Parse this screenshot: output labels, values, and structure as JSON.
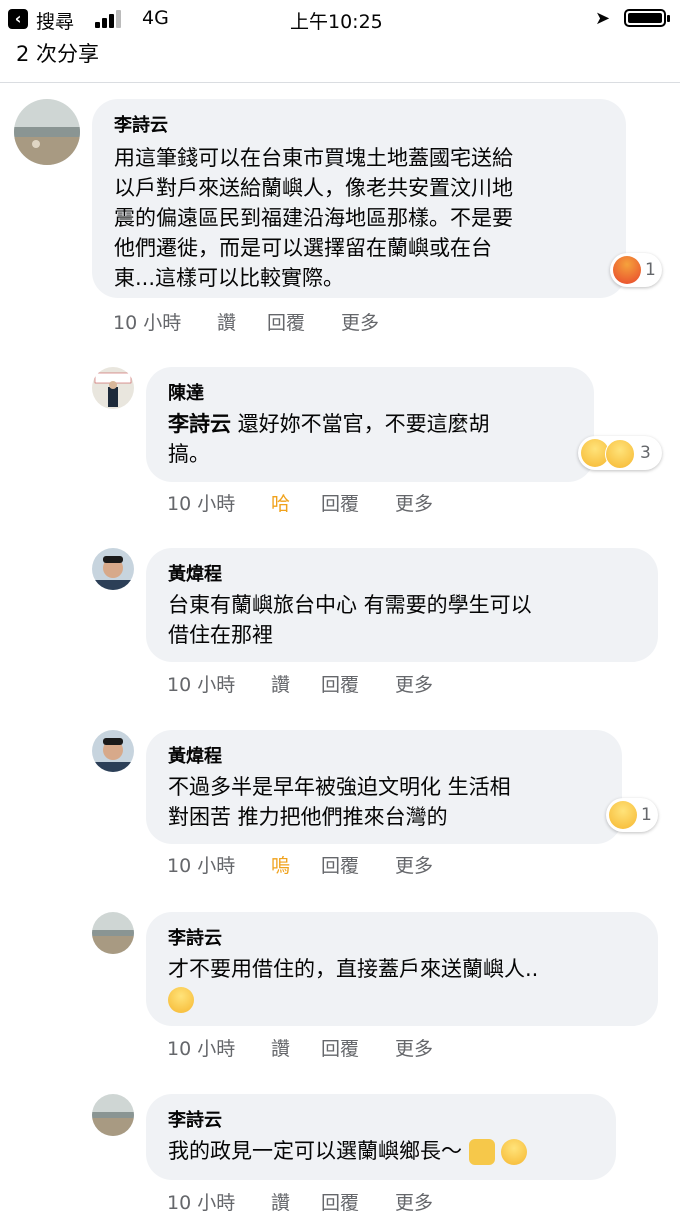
{
  "status": {
    "back_app": "搜尋",
    "network": "4G",
    "time": "上午10:25"
  },
  "share_count": "2 次分享",
  "comments": [
    {
      "author": "李詩云",
      "lines": [
        "用這筆錢可以在台東市買塊土地蓋國宅送給",
        "以戶對戶來送給蘭嶼人，像老共安置汶川地",
        "震的偏遠區民到福建沿海地區那樣。不是要",
        "他們遷徙，而是可以選擇留在蘭嶼或在台",
        "東...這樣可以比較實際。"
      ],
      "time": "10 小時",
      "like": "讚",
      "reply": "回覆",
      "more": "更多",
      "reaction": "angry-emoji",
      "reaction_count": "1"
    },
    {
      "author": "陳達",
      "mention": "李詩云",
      "line1": " 還好妳不當官，不要這麼胡",
      "line2": "搞。",
      "time": "10 小時",
      "like": "哈",
      "reply": "回覆",
      "more": "更多",
      "reactions": [
        "haha-emoji",
        "wow-emoji"
      ],
      "reaction_count": "3"
    },
    {
      "author": "黃煒程",
      "lines": [
        "台東有蘭嶼旅台中心 有需要的學生可以",
        "借住在那裡"
      ],
      "time": "10 小時",
      "like": "讚",
      "reply": "回覆",
      "more": "更多"
    },
    {
      "author": "黃煒程",
      "lines": [
        "不過多半是早年被強迫文明化 生活相",
        "對困苦 推力把他們推來台灣的"
      ],
      "time": "10 小時",
      "like": "嗚",
      "reply": "回覆",
      "more": "更多",
      "reaction": "sad-emoji",
      "reaction_count": "1"
    },
    {
      "author": "李詩云",
      "lines": [
        "才不要用借住的，直接蓋戶來送蘭嶼人.."
      ],
      "time": "10 小時",
      "like": "讚",
      "reply": "回覆",
      "more": "更多"
    },
    {
      "author": "李詩云",
      "lines": [
        "我的政見一定可以選蘭嶼鄉長～"
      ],
      "time": "10 小時",
      "like": "讚",
      "reply": "回覆",
      "more": "更多"
    }
  ],
  "colors": {
    "bubble": "#f0f2f5",
    "meta": "#65676b",
    "reacted": "#f0a21c"
  }
}
